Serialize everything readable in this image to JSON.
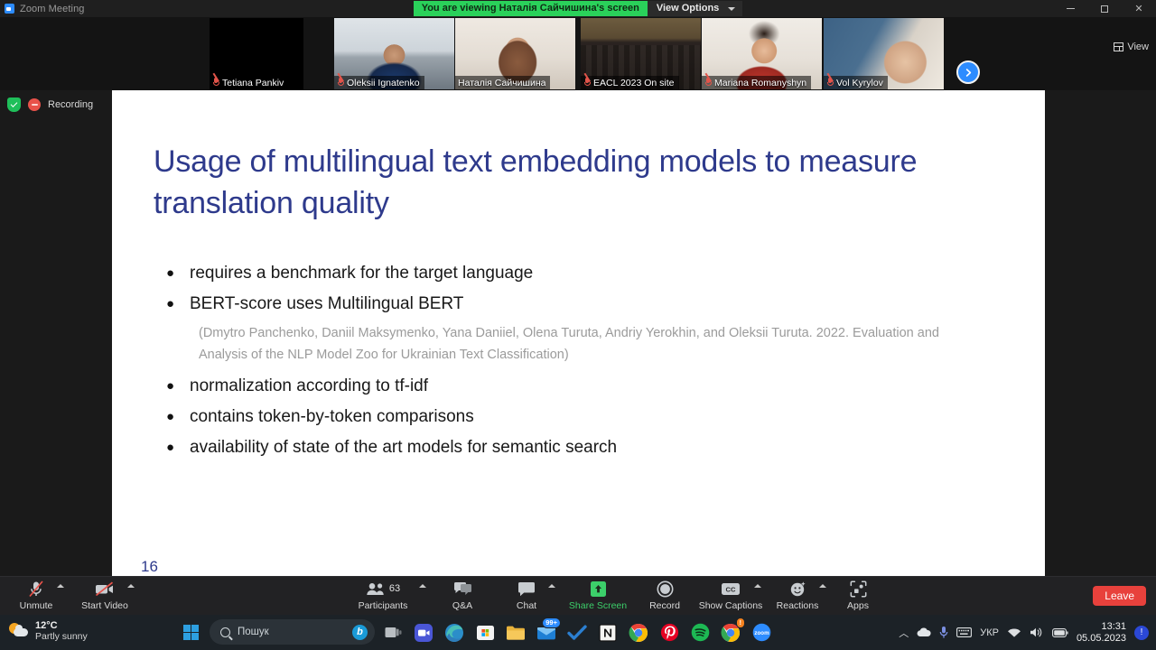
{
  "window": {
    "app_title": "Zoom Meeting",
    "viewing_banner": "You are viewing Наталія Сайчишина's screen",
    "view_options_label": "View Options",
    "view_button_label": "View",
    "minimize_icon": "minimize-icon",
    "maximize_icon": "maximize-icon",
    "close_icon": "close-icon"
  },
  "status": {
    "encryption_icon": "shield-check-icon",
    "recording_label": "Recording"
  },
  "filmstrip": {
    "next_arrow_icon": "chevron-right-icon",
    "participants": [
      {
        "name": "Tetiana Pankiv",
        "muted": true,
        "active": false,
        "video_off": true
      },
      {
        "name": "Oleksii Ignatenko",
        "muted": true,
        "active": false,
        "video_off": false
      },
      {
        "name": "Наталія Сайчишина",
        "muted": false,
        "active": true,
        "video_off": false
      },
      {
        "name": "EACL 2023 On site",
        "muted": true,
        "active": false,
        "video_off": false
      },
      {
        "name": "Mariana Romanyshyn",
        "muted": true,
        "active": false,
        "video_off": false
      },
      {
        "name": "Vol Kyrylov",
        "muted": true,
        "active": false,
        "video_off": false
      }
    ]
  },
  "slide": {
    "title": "Usage of multilingual text embedding models to measure translation quality",
    "title_color": "#2e3a8c",
    "page_number": "16",
    "bullets": [
      {
        "text": "requires a benchmark for the target language",
        "citation": null
      },
      {
        "text": "BERT-score uses Multilingual BERT",
        "citation": "(Dmytro Panchenko, Daniil Maksymenko, Yana Daniiel, Olena Turuta, Andriy Yerokhin, and Oleksii Turuta. 2022. Evaluation and Analysis of the NLP Model Zoo for Ukrainian Text Classification)"
      },
      {
        "text": "normalization according to tf-idf",
        "citation": null
      },
      {
        "text": "contains token-by-token comparisons",
        "citation": null
      },
      {
        "text": "availability of state of the art models for semantic search",
        "citation": null
      }
    ]
  },
  "zoom_toolbar": {
    "items": [
      {
        "label": "Unmute",
        "icon": "microphone-muted-icon",
        "caret": true,
        "accent": "red"
      },
      {
        "label": "Start Video",
        "icon": "camera-muted-icon",
        "caret": true,
        "accent": "red"
      },
      {
        "label": "Participants",
        "icon": "participants-icon",
        "caret": true,
        "count": "63"
      },
      {
        "label": "Q&A",
        "icon": "qa-icon",
        "caret": false
      },
      {
        "label": "Chat",
        "icon": "chat-icon",
        "caret": true
      },
      {
        "label": "Share Screen",
        "icon": "share-screen-icon",
        "caret": false,
        "accent": "green"
      },
      {
        "label": "Record",
        "icon": "record-icon",
        "caret": false
      },
      {
        "label": "Show Captions",
        "icon": "closed-captions-icon",
        "caret": true
      },
      {
        "label": "Reactions",
        "icon": "reactions-icon",
        "caret": true
      },
      {
        "label": "Apps",
        "icon": "apps-icon",
        "caret": false
      }
    ],
    "leave_label": "Leave",
    "leave_color": "#e8413c"
  },
  "taskbar": {
    "weather": {
      "temperature": "12°C",
      "condition": "Partly sunny",
      "icon": "sun-cloud-icon"
    },
    "start_icon": "windows-start-icon",
    "search": {
      "placeholder": "Пошук",
      "icon": "search-icon",
      "assistant_icon": "bing-icon"
    },
    "apps": [
      {
        "icon": "task-view-icon",
        "running": false,
        "badge": null
      },
      {
        "icon": "zoom-icon",
        "running": false,
        "badge": null
      },
      {
        "icon": "edge-icon",
        "running": true,
        "badge": null
      },
      {
        "icon": "microsoft-store-icon",
        "running": false,
        "badge": null
      },
      {
        "icon": "file-explorer-icon",
        "running": false,
        "badge": null
      },
      {
        "icon": "mail-icon",
        "running": false,
        "badge": "99+"
      },
      {
        "icon": "todo-icon",
        "running": false,
        "badge": null
      },
      {
        "icon": "notion-icon",
        "running": false,
        "badge": null
      },
      {
        "icon": "chrome-icon",
        "running": false,
        "badge": null
      },
      {
        "icon": "pinterest-icon",
        "running": false,
        "badge": null
      },
      {
        "icon": "spotify-icon",
        "running": true,
        "badge": null
      },
      {
        "icon": "chrome-icon",
        "running": true,
        "badge": "!"
      },
      {
        "icon": "zoom-app-icon",
        "running": true,
        "badge": null
      }
    ],
    "tray": {
      "overflow_icon": "chevron-up-icon",
      "onedrive_icon": "cloud-icon",
      "mic_icon": "microphone-icon",
      "keyboard_icon": "keyboard-icon",
      "language": "УКР",
      "wifi_icon": "wifi-icon",
      "volume_icon": "speaker-icon",
      "battery_icon": "battery-icon",
      "time": "13:31",
      "date": "05.05.2023",
      "notification_icon": "notification-icon"
    }
  }
}
